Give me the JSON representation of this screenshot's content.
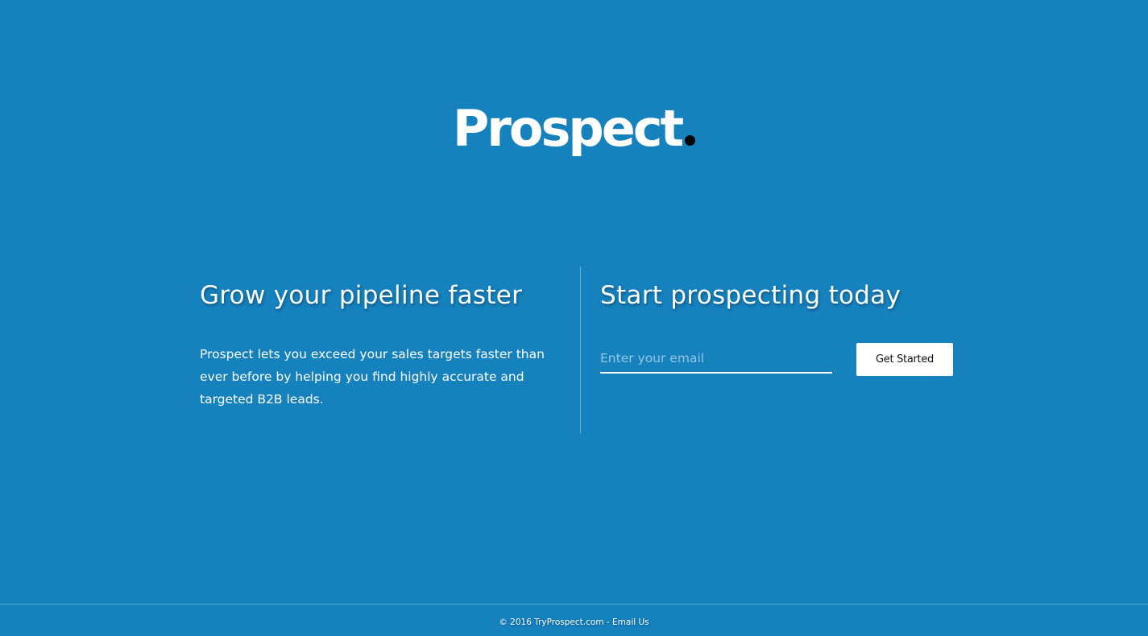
{
  "brand": {
    "name": "Prospect",
    "dot_color": "#000000",
    "background_color": "#1581bd"
  },
  "left": {
    "headline": "Grow your pipeline faster",
    "description": "Prospect lets you exceed your sales targets faster than ever before by helping you find highly accurate and targeted B2B leads."
  },
  "right": {
    "headline": "Start prospecting today",
    "email_placeholder": "Enter your email",
    "email_value": "",
    "cta_label": "Get Started"
  },
  "footer": {
    "copyright": "© 2016 TryProspect.com",
    "separator": " - ",
    "email_link": "Email Us"
  }
}
